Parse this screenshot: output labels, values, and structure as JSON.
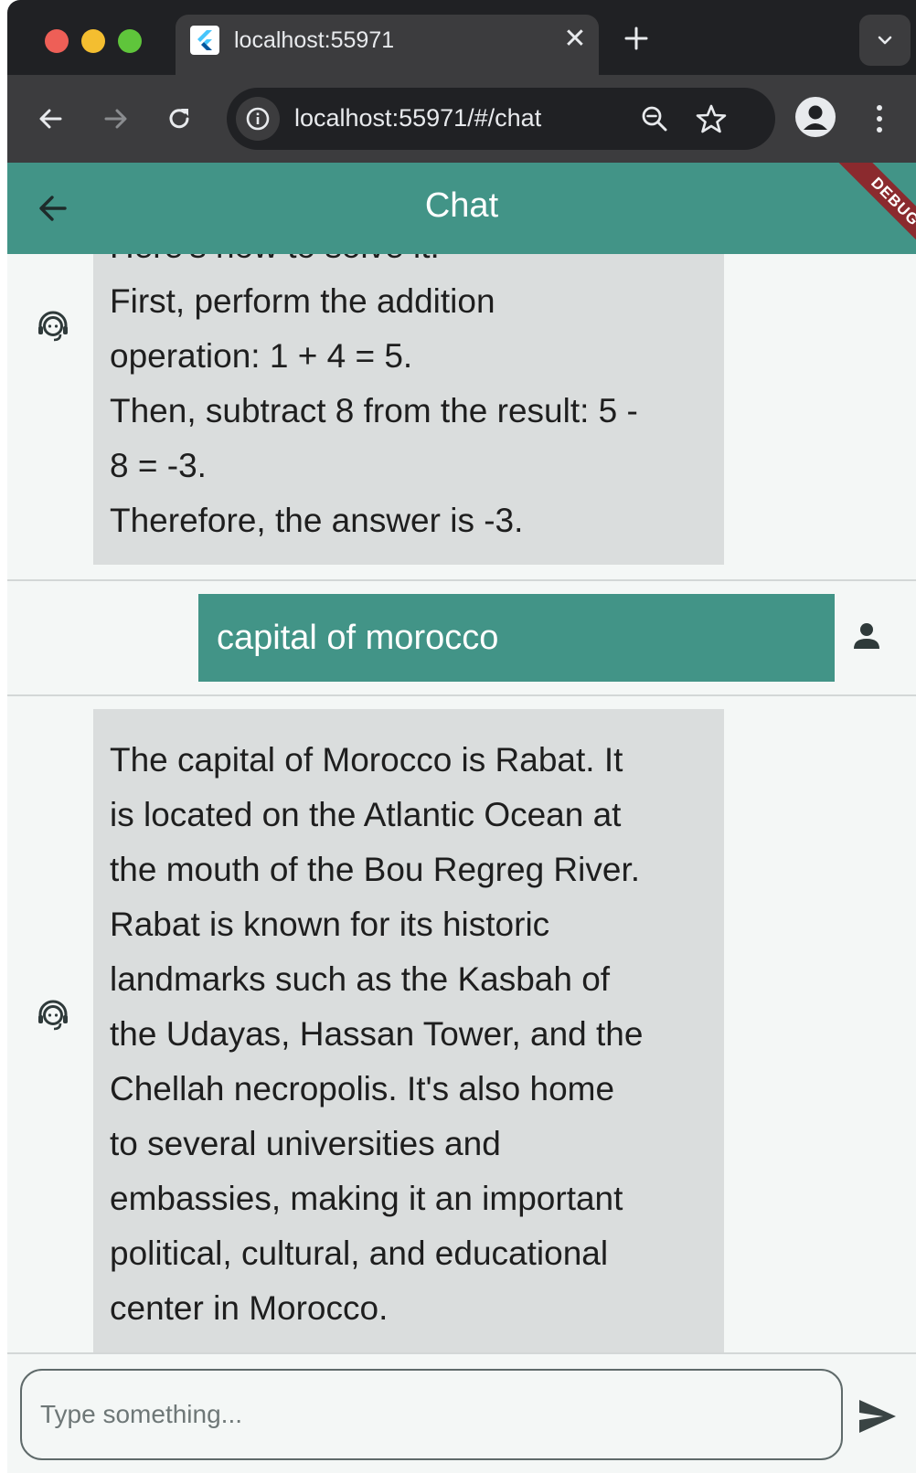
{
  "browser": {
    "tab_title": "localhost:55971",
    "url": "localhost:55971/#/chat",
    "close_glyph": "✕"
  },
  "app": {
    "title": "Chat",
    "debug_label": "DEBUG",
    "accent_color": "#429487"
  },
  "messages": [
    {
      "sender": "bot",
      "lines": [
        "Here's how to solve it:",
        "First, perform the addition",
        "operation: 1 + 4 = 5.",
        "Then, subtract 8 from the result: 5 -",
        "8 = -3.",
        "Therefore, the answer is -3."
      ]
    },
    {
      "sender": "user",
      "text": "capital of morocco"
    },
    {
      "sender": "bot",
      "lines": [
        "The capital of Morocco is Rabat. It",
        "is located on the Atlantic Ocean at",
        "the mouth of the Bou Regreg River.",
        "Rabat is known for its historic",
        "landmarks such as the Kasbah of",
        "the Udayas, Hassan Tower, and the",
        "Chellah necropolis. It's also home",
        "to several universities and",
        "embassies, making it an important",
        "political, cultural, and educational",
        "center in Morocco."
      ]
    }
  ],
  "composer": {
    "placeholder": "Type something..."
  },
  "icons": {
    "bot": "support-agent-icon",
    "user": "person-icon",
    "send": "send-icon"
  }
}
